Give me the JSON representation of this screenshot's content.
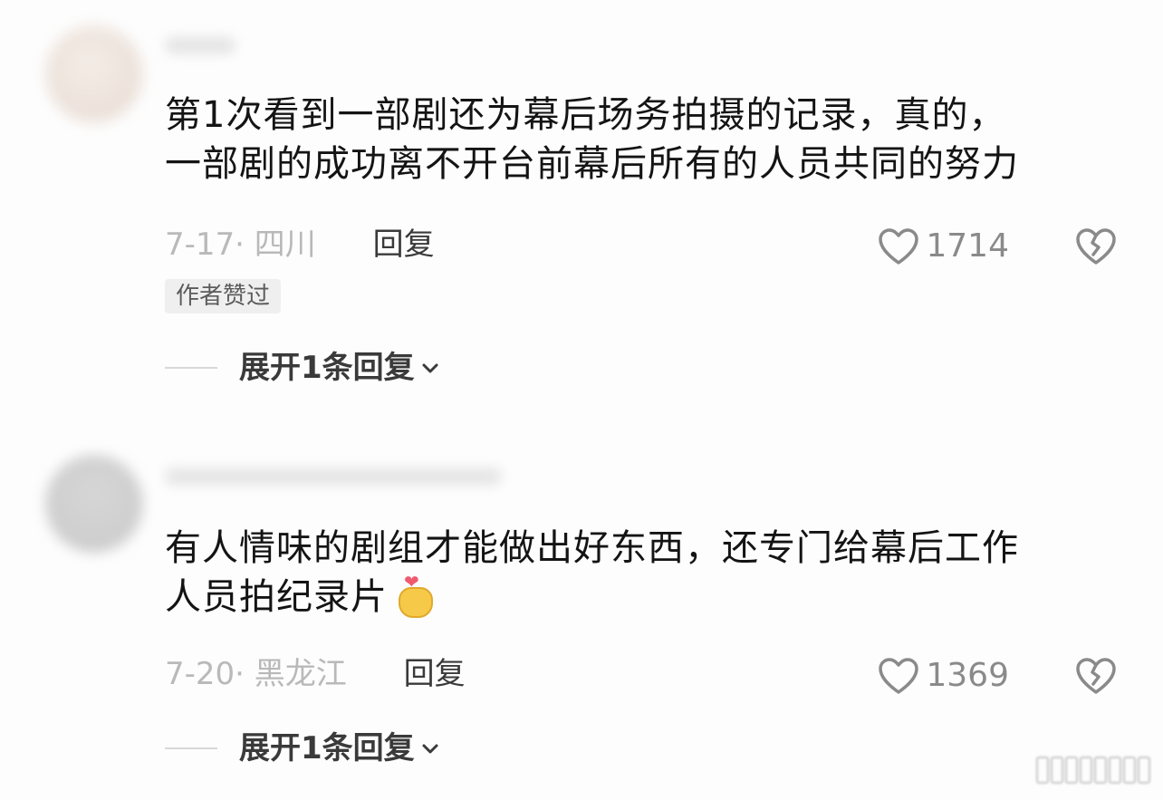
{
  "comments": [
    {
      "username": "",
      "text": "第1次看到一部剧还为幕后场务拍摄的记录，真的，\n一部剧的成功离不开台前幕后所有的人员共同的努力",
      "date_location": "7-17· 四川",
      "reply_label": "回复",
      "likes": "1714",
      "badge": "作者赞过",
      "expand_label": "展开1条回复"
    },
    {
      "username": "",
      "text": "有人情味的剧组才能做出好东西，还专门给幕后工作\n人员拍纪录片",
      "emoji": "finger-heart-emoji",
      "date_location": "7-20· 黑龙江",
      "reply_label": "回复",
      "likes": "1369",
      "expand_label": "展开1条回复"
    }
  ],
  "icons": {
    "like": "heart-outline-icon",
    "dislike": "broken-heart-icon",
    "expand": "chevron-down-icon"
  },
  "colors": {
    "meta_gray": "#b9b9b9",
    "like_gray": "#8a8a8a",
    "badge_bg": "#efefef"
  }
}
